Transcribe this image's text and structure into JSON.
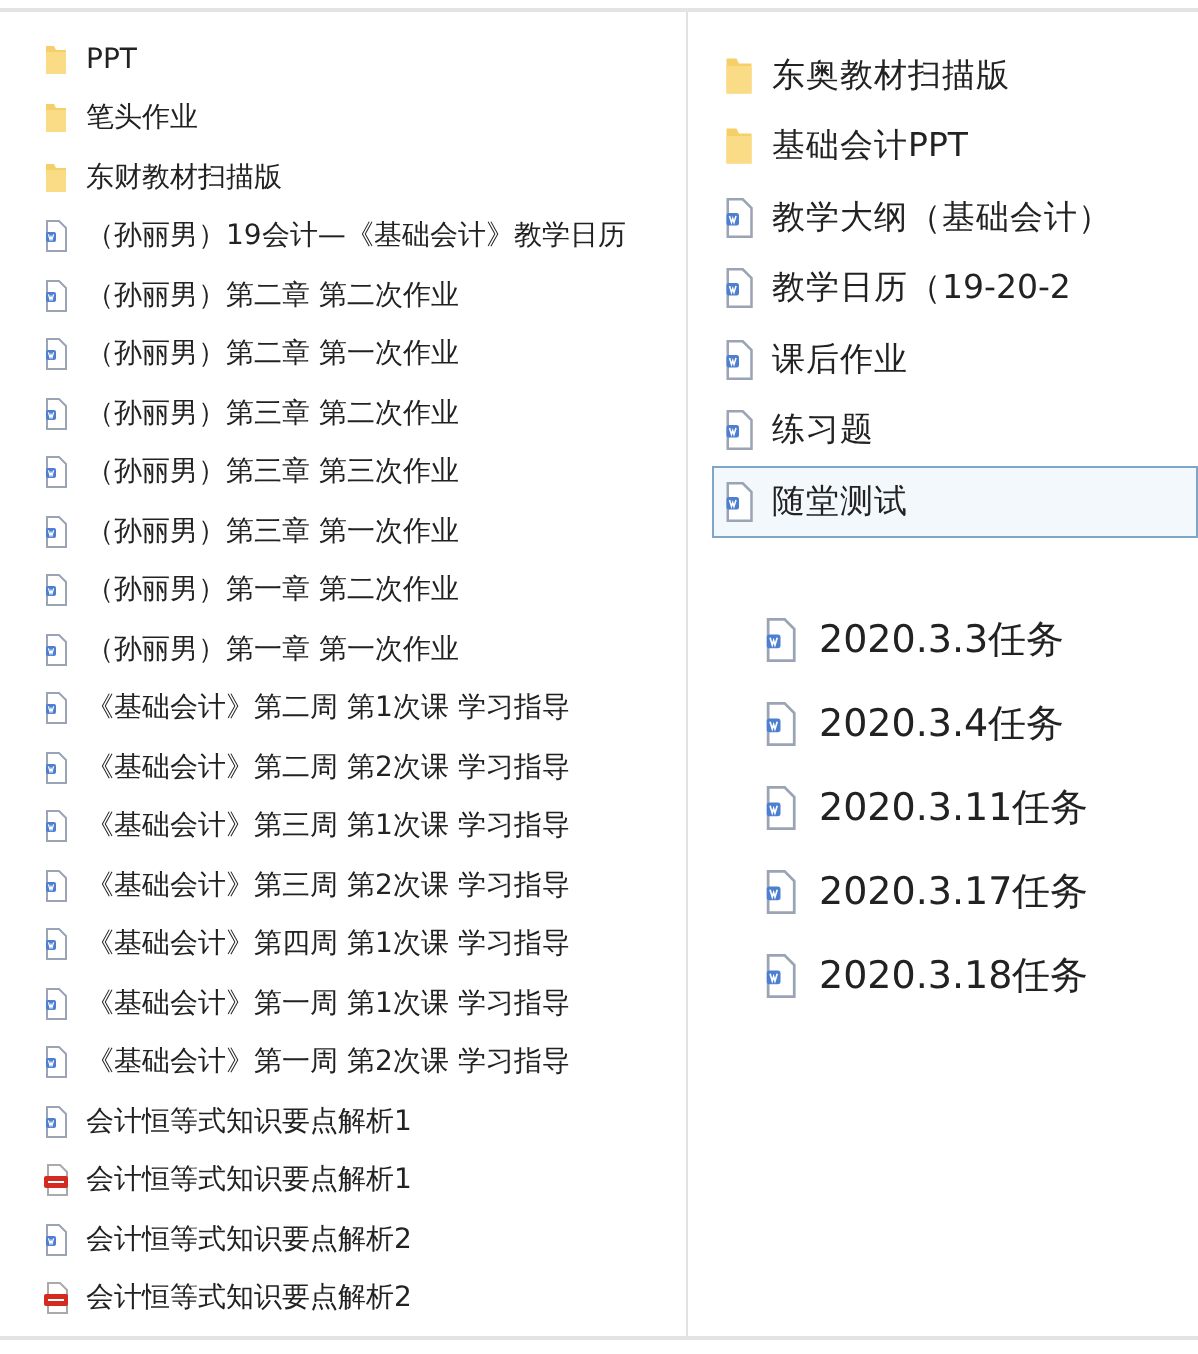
{
  "left_list": {
    "items": [
      {
        "name": "PPT",
        "kind": "folder"
      },
      {
        "name": "笔头作业",
        "kind": "folder"
      },
      {
        "name": "东财教材扫描版",
        "kind": "folder"
      },
      {
        "name": "（孙丽男）19会计—《基础会计》教学日历",
        "kind": "word"
      },
      {
        "name": "（孙丽男）第二章 第二次作业",
        "kind": "word"
      },
      {
        "name": "（孙丽男）第二章 第一次作业",
        "kind": "word"
      },
      {
        "name": "（孙丽男）第三章 第二次作业",
        "kind": "word"
      },
      {
        "name": "（孙丽男）第三章 第三次作业",
        "kind": "word"
      },
      {
        "name": "（孙丽男）第三章 第一次作业",
        "kind": "word"
      },
      {
        "name": "（孙丽男）第一章 第二次作业",
        "kind": "word"
      },
      {
        "name": "（孙丽男）第一章 第一次作业",
        "kind": "word"
      },
      {
        "name": "《基础会计》第二周 第1次课 学习指导",
        "kind": "word"
      },
      {
        "name": "《基础会计》第二周 第2次课 学习指导",
        "kind": "word"
      },
      {
        "name": "《基础会计》第三周 第1次课 学习指导",
        "kind": "word"
      },
      {
        "name": "《基础会计》第三周 第2次课 学习指导",
        "kind": "word"
      },
      {
        "name": "《基础会计》第四周 第1次课 学习指导",
        "kind": "word"
      },
      {
        "name": "《基础会计》第一周 第1次课 学习指导",
        "kind": "word"
      },
      {
        "name": "《基础会计》第一周 第2次课 学习指导",
        "kind": "word"
      },
      {
        "name": "会计恒等式知识要点解析1",
        "kind": "word"
      },
      {
        "name": "会计恒等式知识要点解析1",
        "kind": "pdf"
      },
      {
        "name": "会计恒等式知识要点解析2",
        "kind": "word"
      },
      {
        "name": "会计恒等式知识要点解析2",
        "kind": "pdf"
      }
    ]
  },
  "right_panel": {
    "items": [
      {
        "name": "东奥教材扫描版",
        "kind": "folder",
        "selected": false
      },
      {
        "name": "基础会计PPT",
        "kind": "folder",
        "selected": false
      },
      {
        "name": "教学大纲（基础会计）",
        "kind": "word",
        "selected": false
      },
      {
        "name": "教学日历（19-20-2",
        "kind": "word",
        "selected": false
      },
      {
        "name": "课后作业",
        "kind": "word",
        "selected": false
      },
      {
        "name": "练习题",
        "kind": "word",
        "selected": false
      },
      {
        "name": "随堂测试",
        "kind": "word",
        "selected": true
      }
    ]
  },
  "task_list": {
    "items": [
      {
        "name": "2020.3.3任务",
        "kind": "word"
      },
      {
        "name": "2020.3.4任务",
        "kind": "word"
      },
      {
        "name": "2020.3.11任务",
        "kind": "word"
      },
      {
        "name": "2020.3.17任务",
        "kind": "word"
      },
      {
        "name": "2020.3.18任务",
        "kind": "word"
      }
    ]
  }
}
